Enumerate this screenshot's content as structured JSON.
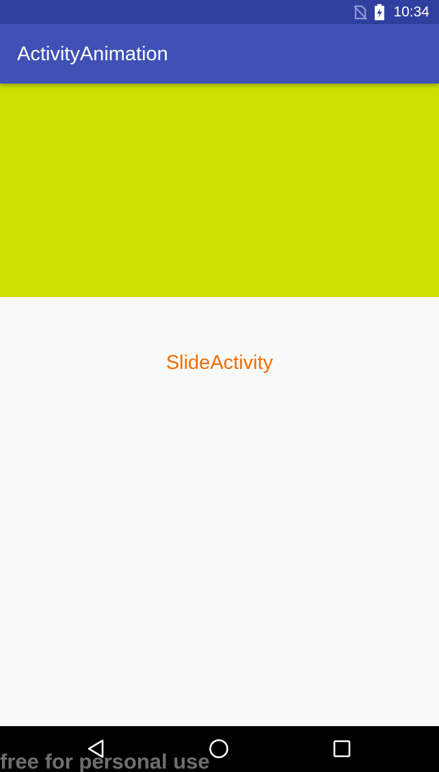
{
  "status_bar": {
    "time": "10:34",
    "icons": [
      "no-sim-icon",
      "battery-charging-icon"
    ]
  },
  "app_bar": {
    "title": "ActivityAnimation"
  },
  "hero_block": {
    "color": "#cddf00"
  },
  "content": {
    "label": "SlideActivity",
    "label_color": "#ef6c00"
  },
  "nav_bar": {
    "buttons": [
      "back-icon",
      "home-icon",
      "recents-icon"
    ]
  },
  "watermark": {
    "text": "free for personal use"
  },
  "colors": {
    "status_bar": "#303f9f",
    "app_bar": "#3f51b5",
    "background": "#fafafa",
    "nav_bar": "#000000"
  }
}
